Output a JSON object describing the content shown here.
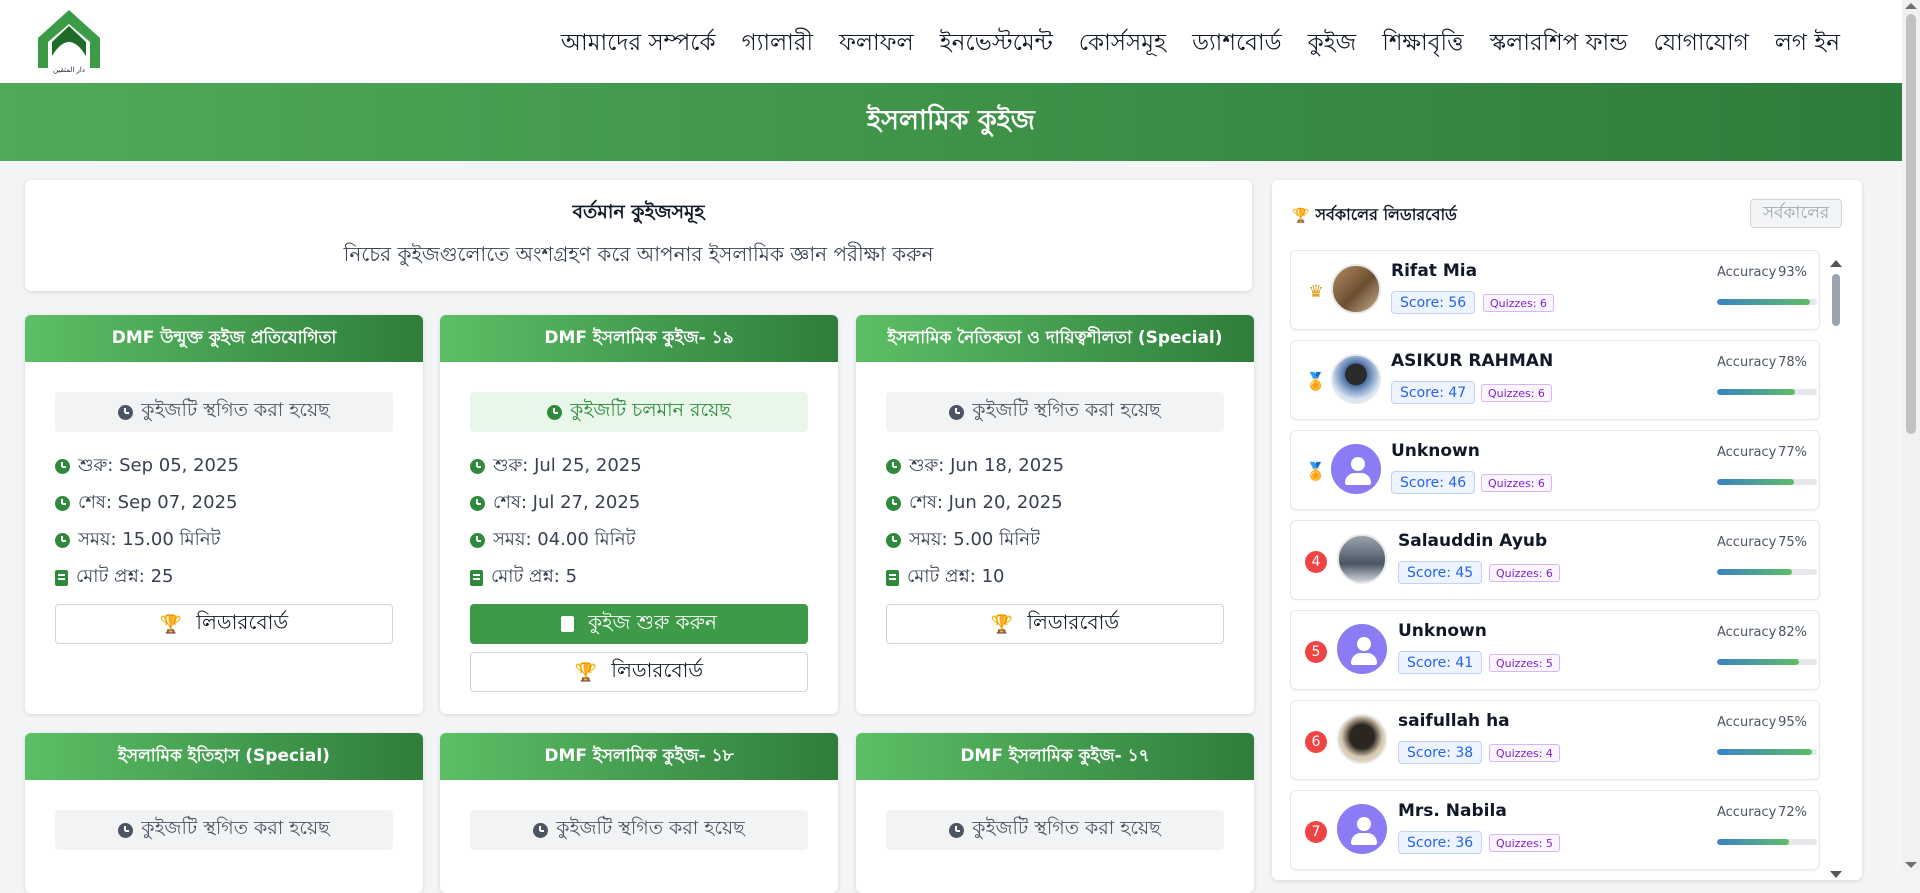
{
  "nav": {
    "items": [
      "আমাদের সম্পর্কে",
      "গ্যালারী",
      "ফলাফল",
      "ইনভেস্টমেন্ট",
      "কোর্সসমূহ",
      "ড্যাশবোর্ড",
      "কুইজ",
      "শিক্ষাবৃত্তি",
      "স্কলারশিপ ফান্ড",
      "যোগাযোগ",
      "লগ ইন"
    ],
    "logo_text": "دار المتقين"
  },
  "banner": {
    "title": "ইসলামিক কুইজ"
  },
  "intro": {
    "heading": "বর্তমান কুইজসমূহ",
    "subtitle": "নিচের কুইজগুলোতে অংশগ্রহণ করে আপনার ইসলামিক জ্ঞান পরীক্ষা করুন"
  },
  "quizzes": [
    {
      "title": "DMF উন্মুক্ত কুইজ প্রতিযোগিতা",
      "status": "কুইজটি স্থগিত করা হয়েছ",
      "running": false,
      "start": "শুরু: Sep 05, 2025",
      "end": "শেষ: Sep 07, 2025",
      "duration": "সময়: 15.00 মিনিট",
      "questions": "মোট প্রশ্ন: 25",
      "leaderboard": "লিডারবোর্ড"
    },
    {
      "title": "DMF ইসলামিক কুইজ- ১৯",
      "status": "কুইজটি চলমান রয়েছ",
      "running": true,
      "start": "শুরু: Jul 25, 2025",
      "end": "শেষ: Jul 27, 2025",
      "duration": "সময়: 04.00 মিনিট",
      "questions": "মোট প্রশ্ন: 5",
      "start_btn": "কুইজ শুরু করুন",
      "leaderboard": "লিডারবোর্ড"
    },
    {
      "title": "ইসলামিক নৈতিকতা ও দায়িত্বশীলতা (Special)",
      "status": "কুইজটি স্থগিত করা হয়েছ",
      "running": false,
      "start": "শুরু: Jun 18, 2025",
      "end": "শেষ: Jun 20, 2025",
      "duration": "সময়: 5.00 মিনিট",
      "questions": "মোট প্রশ্ন: 10",
      "leaderboard": "লিডারবোর্ড"
    },
    {
      "title": "ইসলামিক ইতিহাস (Special)",
      "status": "কুইজটি স্থগিত করা হয়েছ",
      "running": false
    },
    {
      "title": "DMF ইসলামিক কুইজ- ১৮",
      "status": "কুইজটি স্থগিত করা হয়েছ",
      "running": false
    },
    {
      "title": "DMF ইসলামিক কুইজ- ১৭",
      "status": "কুইজটি স্থগিত করা হয়েছ",
      "running": false
    }
  ],
  "leaderboard": {
    "title": "সর্বকালের লিডারবোর্ড",
    "filter": "সর্বকালের",
    "accuracy_label": "Accuracy",
    "rows": [
      {
        "rank": "1",
        "name": "Rifat Mia",
        "score": "Score: 56",
        "quizzes": "Quizzes: 6",
        "accuracy": "93%",
        "accuracy_value": 93
      },
      {
        "rank": "2",
        "name": "ASIKUR RAHMAN",
        "score": "Score: 47",
        "quizzes": "Quizzes: 6",
        "accuracy": "78%",
        "accuracy_value": 78
      },
      {
        "rank": "3",
        "name": "Unknown",
        "score": "Score: 46",
        "quizzes": "Quizzes: 6",
        "accuracy": "77%",
        "accuracy_value": 77
      },
      {
        "rank": "4",
        "name": "Salauddin Ayub",
        "score": "Score: 45",
        "quizzes": "Quizzes: 6",
        "accuracy": "75%",
        "accuracy_value": 75
      },
      {
        "rank": "5",
        "name": "Unknown",
        "score": "Score: 41",
        "quizzes": "Quizzes: 5",
        "accuracy": "82%",
        "accuracy_value": 82
      },
      {
        "rank": "6",
        "name": "saifullah ha",
        "score": "Score: 38",
        "quizzes": "Quizzes: 4",
        "accuracy": "95%",
        "accuracy_value": 95
      },
      {
        "rank": "7",
        "name": "Mrs. Nabila",
        "score": "Score: 36",
        "quizzes": "Quizzes: 5",
        "accuracy": "72%",
        "accuracy_value": 72
      }
    ]
  },
  "colors": {
    "brand_green": "#3d9b47",
    "banner_dark": "#2e7c3a",
    "rank_red": "#ef4444"
  }
}
